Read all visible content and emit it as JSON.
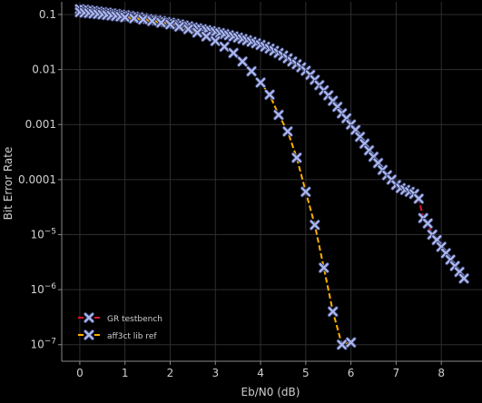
{
  "chart_data": {
    "type": "line",
    "title": "",
    "xlabel": "Eb/N0 (dB)",
    "ylabel": "Bit Error Rate",
    "x_scale": "linear",
    "y_scale": "log",
    "xlim": [
      -0.4,
      8.9
    ],
    "ylim": [
      5e-08,
      0.17
    ],
    "grid": true,
    "legend_position": "lower-left",
    "background": "#000000",
    "grid_color": "#2e2e2e",
    "text_color": "#cfcfcf",
    "marker_color": "#a9b6ee",
    "x_ticks": [
      0,
      1,
      2,
      3,
      4,
      5,
      6,
      7,
      8
    ],
    "x_tick_labels": [
      "0",
      "1",
      "2",
      "3",
      "4",
      "5",
      "6",
      "7",
      "8"
    ],
    "y_ticks": [
      1e-07,
      1e-06,
      1e-05,
      0.0001,
      0.001,
      0.01,
      0.1
    ],
    "y_tick_labels": [
      "10^-7",
      "10^-6",
      "10^-5",
      "0.0001",
      "0.001",
      "0.01",
      "0.1"
    ],
    "series": [
      {
        "name": "GR testbench",
        "color": "#e8112d",
        "x": [
          0,
          0.1,
          0.2,
          0.3,
          0.4,
          0.5,
          0.6,
          0.7,
          0.8,
          0.9,
          1.0,
          1.1,
          1.2,
          1.3,
          1.4,
          1.5,
          1.6,
          1.7,
          1.8,
          1.9,
          2.0,
          2.1,
          2.2,
          2.3,
          2.4,
          2.5,
          2.6,
          2.7,
          2.8,
          2.9,
          3.0,
          3.1,
          3.2,
          3.3,
          3.4,
          3.5,
          3.6,
          3.7,
          3.8,
          3.9,
          4.0,
          4.1,
          4.2,
          4.3,
          4.4,
          4.5,
          4.6,
          4.7,
          4.8,
          4.9,
          5.0,
          5.1,
          5.2,
          5.3,
          5.4,
          5.5,
          5.6,
          5.7,
          5.8,
          5.9,
          6.0,
          6.1,
          6.2,
          6.3,
          6.4,
          6.5,
          6.6,
          6.7,
          6.8,
          6.9,
          7.0,
          7.1,
          7.2,
          7.3,
          7.4,
          7.5,
          7.6,
          7.7,
          7.8,
          7.9,
          8.0,
          8.1,
          8.2,
          8.3,
          8.4,
          8.5
        ],
        "values": [
          0.125,
          0.122,
          0.119,
          0.116,
          0.113,
          0.11,
          0.108,
          0.105,
          0.102,
          0.099,
          0.097,
          0.094,
          0.091,
          0.089,
          0.086,
          0.083,
          0.081,
          0.078,
          0.076,
          0.073,
          0.071,
          0.068,
          0.066,
          0.063,
          0.061,
          0.058,
          0.056,
          0.054,
          0.052,
          0.05,
          0.048,
          0.046,
          0.044,
          0.042,
          0.04,
          0.038,
          0.036,
          0.034,
          0.032,
          0.03,
          0.028,
          0.026,
          0.024,
          0.022,
          0.02,
          0.018,
          0.016,
          0.014,
          0.0125,
          0.011,
          0.0095,
          0.008,
          0.0065,
          0.0052,
          0.0042,
          0.0034,
          0.0027,
          0.0021,
          0.0016,
          0.0013,
          0.001,
          0.0008,
          0.0006,
          0.00045,
          0.00034,
          0.00026,
          0.0002,
          0.00015,
          0.00012,
          0.0001,
          8e-05,
          7e-05,
          6.5e-05,
          6e-05,
          5.5e-05,
          4.5e-05,
          2e-05,
          1.6e-05,
          1e-05,
          8e-06,
          6e-06,
          4.6e-06,
          3.5e-06,
          2.7e-06,
          2.1e-06,
          1.6e-06
        ]
      },
      {
        "name": "aff3ct lib ref",
        "color": "#ffb000",
        "x": [
          0,
          0.1,
          0.2,
          0.3,
          0.4,
          0.5,
          0.6,
          0.7,
          0.8,
          0.9,
          1.0,
          1.2,
          1.4,
          1.6,
          1.8,
          2.0,
          2.2,
          2.4,
          2.6,
          2.8,
          3.0,
          3.2,
          3.4,
          3.6,
          3.8,
          4.0,
          4.2,
          4.4,
          4.6,
          4.8,
          5.0,
          5.2,
          5.4,
          5.6,
          5.8,
          6.0
        ],
        "values": [
          0.11,
          0.108,
          0.106,
          0.104,
          0.102,
          0.1,
          0.098,
          0.096,
          0.094,
          0.092,
          0.089,
          0.085,
          0.081,
          0.076,
          0.071,
          0.066,
          0.06,
          0.054,
          0.047,
          0.04,
          0.033,
          0.026,
          0.02,
          0.014,
          0.0093,
          0.0058,
          0.0035,
          0.0015,
          0.00075,
          0.00025,
          6e-05,
          1.5e-05,
          2.5e-06,
          4e-07,
          1e-07,
          1.1e-07
        ]
      }
    ]
  }
}
